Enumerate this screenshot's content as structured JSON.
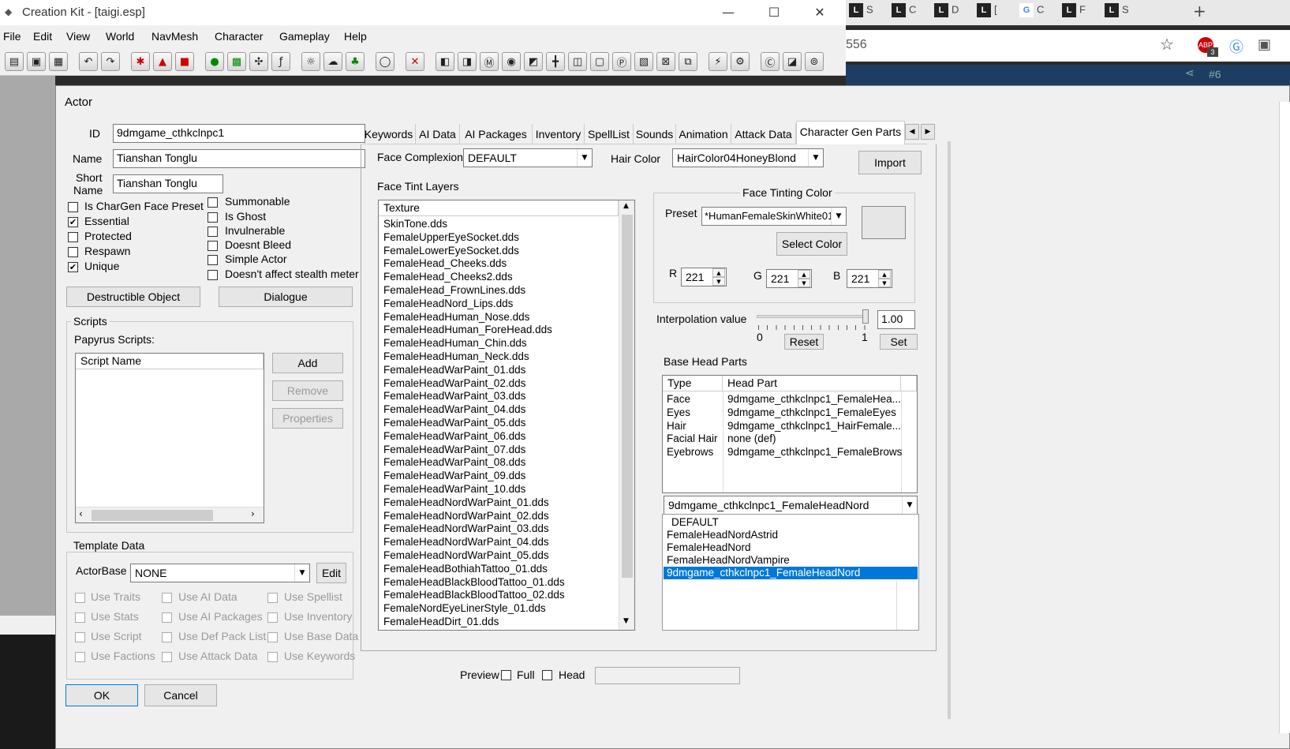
{
  "ck": {
    "title": "Creation Kit - [taigi.esp]",
    "menu": [
      "File",
      "Edit",
      "View",
      "World",
      "NavMesh",
      "Character",
      "Gameplay",
      "Help"
    ]
  },
  "browser": {
    "address_fragment": "556",
    "tabs": [
      {
        "icon": "L",
        "letter": "S"
      },
      {
        "icon": "L",
        "letter": "C"
      },
      {
        "icon": "L",
        "letter": "D"
      },
      {
        "icon": "L",
        "letter": "["
      },
      {
        "icon": "G",
        "letter": "C"
      },
      {
        "icon": "L",
        "letter": "F"
      },
      {
        "icon": "L",
        "letter": "S"
      }
    ],
    "extension_badge": "3",
    "page_fragment": "#6"
  },
  "dialog": {
    "title": "Actor",
    "id_label": "ID",
    "id_value": "9dmgame_cthkclnpc1",
    "name_label": "Name",
    "name_value": "Tianshan Tonglu",
    "short_name_label_1": "Short",
    "short_name_label_2": "Name",
    "short_name_value": "Tianshan Tonglu",
    "flags_left": [
      {
        "label": "Is CharGen Face Preset",
        "checked": false
      },
      {
        "label": "Essential",
        "checked": true
      },
      {
        "label": "Protected",
        "checked": false
      },
      {
        "label": "Respawn",
        "checked": false
      },
      {
        "label": "Unique",
        "checked": true
      }
    ],
    "flags_right": [
      {
        "label": "Summonable",
        "checked": false
      },
      {
        "label": "Is Ghost",
        "checked": false
      },
      {
        "label": "Invulnerable",
        "checked": false
      },
      {
        "label": "Doesnt Bleed",
        "checked": false
      },
      {
        "label": "Simple Actor",
        "checked": false
      },
      {
        "label": "Doesn't affect stealth meter",
        "checked": false
      }
    ],
    "destructible_btn": "Destructible Object",
    "dialogue_btn": "Dialogue",
    "scripts": {
      "group_title": "Scripts",
      "papyrus_label": "Papyrus Scripts:",
      "col_header": "Script Name",
      "add": "Add",
      "remove": "Remove",
      "properties": "Properties"
    },
    "template": {
      "group_title": "Template Data",
      "actorbase_label": "ActorBase",
      "actorbase_value": "NONE",
      "edit": "Edit",
      "uses": [
        "Use Traits",
        "Use AI Data",
        "Use Spellist",
        "Use Stats",
        "Use AI Packages",
        "Use Inventory",
        "Use Script",
        "Use Def Pack List",
        "Use Base Data",
        "Use Factions",
        "Use Attack Data",
        "Use Keywords"
      ]
    },
    "ok": "OK",
    "cancel": "Cancel",
    "tabs": [
      "Keywords",
      "AI Data",
      "AI Packages",
      "Inventory",
      "SpellList",
      "Sounds",
      "Animation",
      "Attack Data",
      "Character Gen Parts"
    ],
    "active_tab": "Character Gen Parts",
    "face_complexion_label": "Face Complexion",
    "face_complexion_value": "DEFAULT",
    "hair_color_label": "Hair Color",
    "hair_color_value": "HairColor04HoneyBlond",
    "import": "Import",
    "face_tint_layers_label": "Face Tint Layers",
    "texture_header": "Texture",
    "textures": [
      "SkinTone.dds",
      "FemaleUpperEyeSocket.dds",
      "FemaleLowerEyeSocket.dds",
      "FemaleHead_Cheeks.dds",
      "FemaleHead_Cheeks2.dds",
      "FemaleHead_FrownLines.dds",
      "FemaleHeadNord_Lips.dds",
      "FemaleHeadHuman_Nose.dds",
      "FemaleHeadHuman_ForeHead.dds",
      "FemaleHeadHuman_Chin.dds",
      "FemaleHeadHuman_Neck.dds",
      "FemaleHeadWarPaint_01.dds",
      "FemaleHeadWarPaint_02.dds",
      "FemaleHeadWarPaint_03.dds",
      "FemaleHeadWarPaint_04.dds",
      "FemaleHeadWarPaint_05.dds",
      "FemaleHeadWarPaint_06.dds",
      "FemaleHeadWarPaint_07.dds",
      "FemaleHeadWarPaint_08.dds",
      "FemaleHeadWarPaint_09.dds",
      "FemaleHeadWarPaint_10.dds",
      "FemaleHeadNordWarPaint_01.dds",
      "FemaleHeadNordWarPaint_02.dds",
      "FemaleHeadNordWarPaint_03.dds",
      "FemaleHeadNordWarPaint_04.dds",
      "FemaleHeadNordWarPaint_05.dds",
      "FemaleHeadBothiahTattoo_01.dds",
      "FemaleHeadBlackBloodTattoo_01.dds",
      "FemaleHeadBlackBloodTattoo_02.dds",
      "FemaleNordEyeLinerStyle_01.dds",
      "FemaleHeadDirt_01.dds"
    ],
    "tinting": {
      "group_title": "Face Tinting Color",
      "preset_label": "Preset",
      "preset_value": "*HumanFemaleSkinWhite01",
      "select_color": "Select Color",
      "swatch_color": "#e6e6e6",
      "r_label": "R",
      "r_value": "221",
      "g_label": "G",
      "g_value": "221",
      "b_label": "B",
      "b_value": "221"
    },
    "interpolation_label": "Interpolation value",
    "interpolation_value": "1.00",
    "slider_min": "0",
    "slider_max": "1",
    "reset": "Reset",
    "set": "Set",
    "base_head_parts_label": "Base Head Parts",
    "head_parts_headers": [
      "Type",
      "Head Part"
    ],
    "head_parts": [
      {
        "type": "Face",
        "part": "9dmgame_cthkclnpc1_FemaleHea..."
      },
      {
        "type": "Eyes",
        "part": "9dmgame_cthkclnpc1_FemaleEyes"
      },
      {
        "type": "Hair",
        "part": "9dmgame_cthkclnpc1_HairFemale..."
      },
      {
        "type": "Facial Hair",
        "part": "none (def)"
      },
      {
        "type": "Eyebrows",
        "part": "9dmgame_cthkclnpc1_FemaleBrows"
      }
    ],
    "head_part_combo_value": "9dmgame_cthkclnpc1_FemaleHeadNord",
    "head_part_options": [
      "DEFAULT",
      "FemaleHeadNordAstrid",
      "FemaleHeadNord",
      "FemaleHeadNordVampire",
      "9dmgame_cthkclnpc1_FemaleHeadNord"
    ],
    "head_part_selected_index": 4,
    "preview_label": "Preview",
    "full_label": "Full",
    "head_label": "Head"
  },
  "colors": {
    "selection": "#0078d7",
    "dialog_bg": "#f0f0f0"
  }
}
